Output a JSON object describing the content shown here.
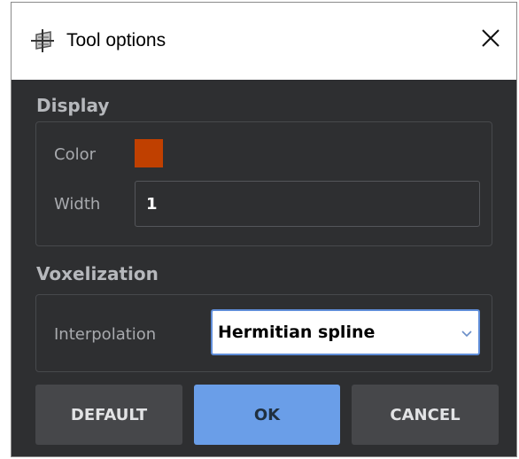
{
  "window": {
    "title": "Tool options",
    "title_icon": "plane-crosshair-icon",
    "close_icon": "close-icon"
  },
  "display": {
    "section_title": "Display",
    "color_label": "Color",
    "color_value": "#c04000",
    "width_label": "Width",
    "width_value": "1"
  },
  "voxelization": {
    "section_title": "Voxelization",
    "interpolation_label": "Interpolation",
    "interpolation_value": "Hermitian spline",
    "chevron_icon": "chevron-down-icon"
  },
  "buttons": {
    "default_label": "DEFAULT",
    "ok_label": "OK",
    "cancel_label": "CANCEL"
  },
  "colors": {
    "dialog_background": "#2e2f31",
    "accent": "#6a9ee8",
    "swatch": "#c04000"
  }
}
